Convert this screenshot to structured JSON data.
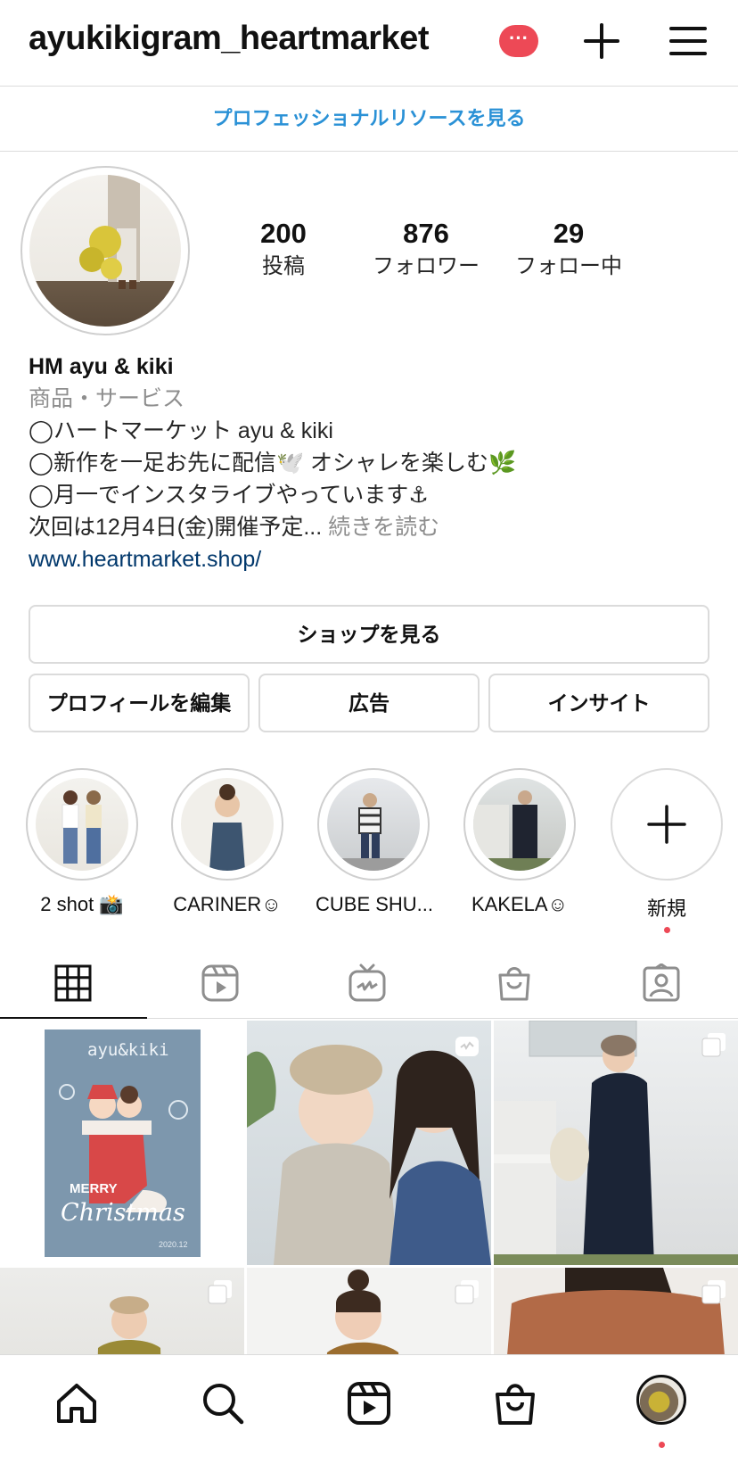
{
  "header": {
    "username": "ayukikigram_heartmarket",
    "badge": "···"
  },
  "pro_bar": "プロフェッショナルリソースを見る",
  "stats": [
    {
      "value": "200",
      "label": "投稿"
    },
    {
      "value": "876",
      "label": "フォロワー"
    },
    {
      "value": "29",
      "label": "フォロー中"
    }
  ],
  "bio": {
    "name": "HM  ayu & kiki",
    "category": "商品・サービス",
    "line1": "◯ハートマーケット ayu & kiki",
    "line2": "◯新作を一足お先に配信🕊️ オシャレを楽しむ🌿",
    "line3": "◯月一でインスタライブやっています⚓",
    "line4": "次回は12月4日(金)開催予定...",
    "more": " 続きを読む",
    "link": "www.heartmarket.shop/"
  },
  "buttons": {
    "shop": "ショップを見る",
    "edit_profile": "プロフィールを編集",
    "ads": "広告",
    "insights": "インサイト"
  },
  "highlights": [
    {
      "label": "2 shot 📸"
    },
    {
      "label": "CARINER☺"
    },
    {
      "label": "CUBE SHU..."
    },
    {
      "label": "KAKELA☺"
    },
    {
      "label": "新規"
    }
  ],
  "post": {
    "brand": "ayu&kiki",
    "greeting": "MERRY",
    "greeting2": "Christmas",
    "date": "2020.12"
  },
  "colors": {
    "accent_blue": "#2a91d6",
    "badge_red": "#ed4956",
    "link": "#00376b",
    "secondary_text": "#8e8e8e"
  }
}
